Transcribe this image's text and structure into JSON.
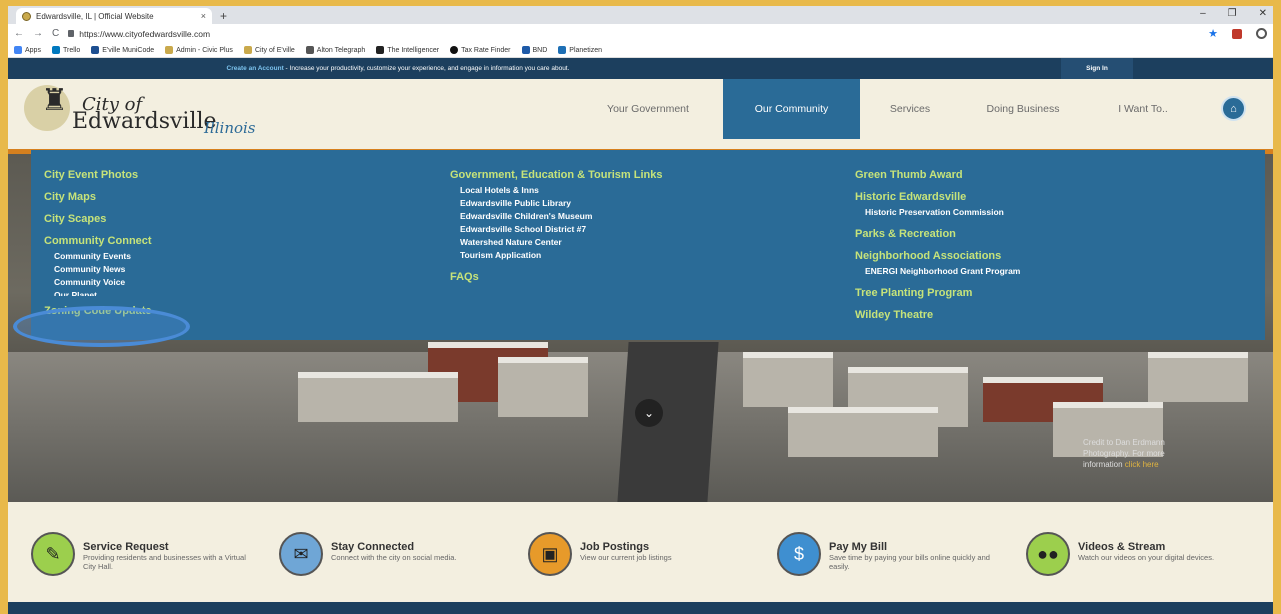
{
  "browser": {
    "tab_title": "Edwardsville, IL | Official Website",
    "tab_close": "×",
    "new_tab": "+",
    "url": "https://www.cityofedwardsville.com",
    "bookmarks": [
      "Apps",
      "Trello",
      "E'ville MuniCode",
      "Admin - Civic Plus",
      "City of E'ville",
      "Alton Telegraph",
      "The Intelligencer",
      "Tax Rate Finder",
      "BND",
      "Planetizen"
    ]
  },
  "utility": {
    "create_account": "Create an Account",
    "message": " - Increase your productivity, customize your experience, and engage in information you care about.",
    "sign_in": "Sign In"
  },
  "logo": {
    "city_of": "City of",
    "name": "Edwardsville",
    "state": "Illinois"
  },
  "nav": {
    "items": [
      "Your Government",
      "Our Community",
      "Services",
      "Doing Business",
      "I Want To.."
    ],
    "active": "Our Community"
  },
  "mega_menu": {
    "col1": {
      "h1": "City Event Photos",
      "h2": "City Maps",
      "h3": "City Scapes",
      "h4": "Community Connect",
      "h4_subs": [
        "Community Events",
        "Community News",
        "Community Voice",
        "Our Planet..."
      ],
      "h5": "Zoning Code Update"
    },
    "col2": {
      "h1": "Government, Education & Tourism Links",
      "h1_subs": [
        "Local Hotels & Inns",
        "Edwardsville Public Library",
        "Edwardsville Children's Museum",
        "Edwardsville School District #7",
        "Watershed Nature Center",
        "Tourism Application"
      ],
      "h2": "FAQs"
    },
    "col3": {
      "h1": "Green Thumb Award",
      "h2": "Historic Edwardsville",
      "h2_subs": [
        "Historic Preservation Commission"
      ],
      "h3": "Parks & Recreation",
      "h4": "Neighborhood Associations",
      "h4_subs": [
        "ENERGI Neighborhood Grant Program"
      ],
      "h5": "Tree Planting Program",
      "h6": "Wildey Theatre"
    }
  },
  "hero": {
    "credit_text": "Credit to Dan Erdmann Photography. For more information ",
    "credit_link": "click here"
  },
  "quick_links": [
    {
      "title": "Service Request",
      "desc": "Providing residents and businesses with a Virtual City Hall.",
      "icon": "wrench-icon",
      "color": "#9ccf4d"
    },
    {
      "title": "Stay Connected",
      "desc": "Connect with the city on social media.",
      "icon": "envelope-icon",
      "color": "#6fa6d6"
    },
    {
      "title": "Job Postings",
      "desc": "View our current job listings",
      "icon": "briefcase-icon",
      "color": "#e79a2a"
    },
    {
      "title": "Pay My Bill",
      "desc": "Save time by paying your bills online quickly and easily.",
      "icon": "dollar-icon",
      "color": "#3f8fd0"
    },
    {
      "title": "Videos & Stream",
      "desc": "Watch our videos on your digital devices.",
      "icon": "camera-icon",
      "color": "#9ccf4d"
    }
  ]
}
